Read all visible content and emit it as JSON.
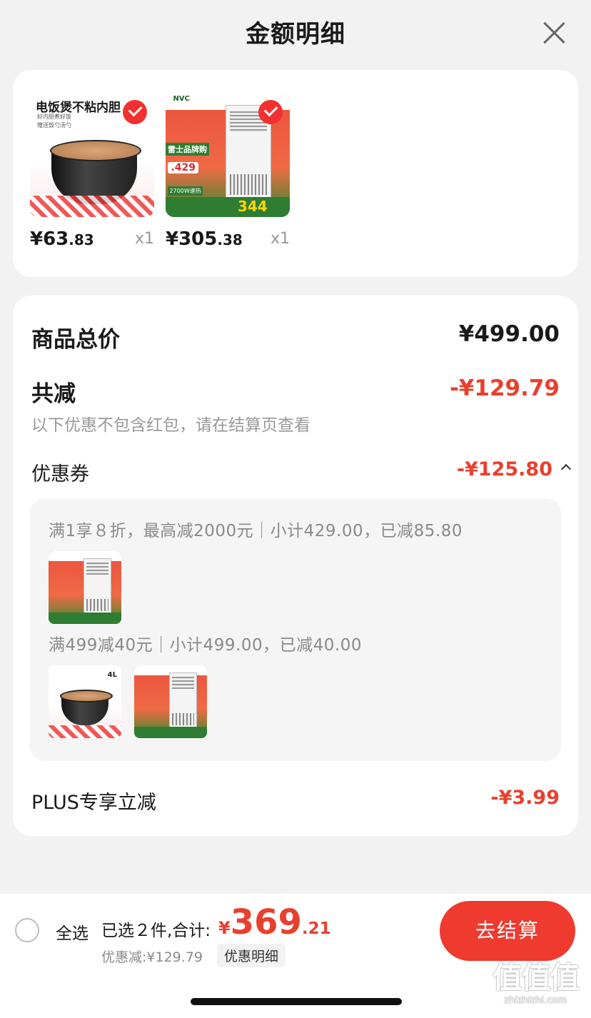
{
  "header": {
    "title": "金额明细",
    "close_icon": "close-icon"
  },
  "products": [
    {
      "image": {
        "title": "电饭煲不粘内胆",
        "sub1": "好内胆煮好饭",
        "sub2": "赠送饭勺汤勺"
      },
      "price_int": "¥63",
      "price_dec": ".83",
      "qty": "x1",
      "checked": true
    },
    {
      "image": {
        "brand": "NVC",
        "tag_a": "雷士品牌购",
        "tag_b": ".429",
        "tag_c": "2700W速热",
        "promo": "344"
      },
      "price_int": "¥305",
      "price_dec": ".38",
      "qty": "x1",
      "checked": true
    }
  ],
  "summary": {
    "total_label": "商品总价",
    "total_value": "¥499.00",
    "reduce_label": "共减",
    "reduce_value": "-¥129.79",
    "reduce_note": "以下优惠不包含红包，请在结算页查看",
    "coupon_label": "优惠券",
    "coupon_value": "-¥125.80",
    "coupons": [
      {
        "text": "满1享８折，最高减2000元｜小计429.00，已减85.80"
      },
      {
        "text": "满499减40元｜小计499.00，已减40.00"
      }
    ],
    "plus_label": "PLUS专享立减",
    "plus_value": "-¥3.99",
    "pot_label_4l": "4L"
  },
  "bottom": {
    "select_all": "全选",
    "selected_text": "已选２件,合计:",
    "total_currency": "¥",
    "total_int": "369",
    "total_dec": ".21",
    "discount_text": "优惠减:¥129.79",
    "detail_btn": "优惠明细",
    "checkout_btn": "去结算"
  },
  "watermark": {
    "logo": "值值值",
    "url": "zhizhizhi.com"
  },
  "colors": {
    "accent_red": "#e8402d",
    "checkout_bg": "#ee3a2f"
  }
}
